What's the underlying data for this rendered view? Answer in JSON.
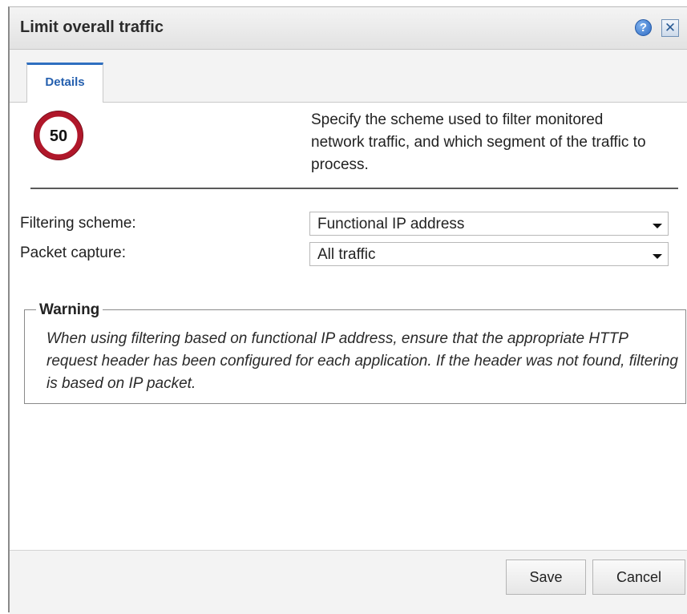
{
  "dialog": {
    "title": "Limit overall traffic",
    "help_label": "?",
    "close_label": "✕"
  },
  "tabs": [
    {
      "label": "Details",
      "active": true
    }
  ],
  "icon": {
    "name": "speed-limit-icon",
    "text": "50",
    "ring_color": "#b0172a"
  },
  "description": "Specify the scheme used to filter monitored network traffic, and which segment of the traffic to process.",
  "fields": {
    "filtering_scheme": {
      "label": "Filtering scheme:",
      "value": "Functional IP address"
    },
    "packet_capture": {
      "label": "Packet capture:",
      "value": "All traffic"
    }
  },
  "warning": {
    "title": "Warning",
    "text": "When using filtering based on functional IP address, ensure that the appropriate HTTP request header has been configured for each application. If the header was not found, filtering is based on IP packet."
  },
  "buttons": {
    "save": "Save",
    "cancel": "Cancel"
  },
  "colors": {
    "tab_accent": "#2f6fc0",
    "help_icon": "#2f6bc3"
  }
}
